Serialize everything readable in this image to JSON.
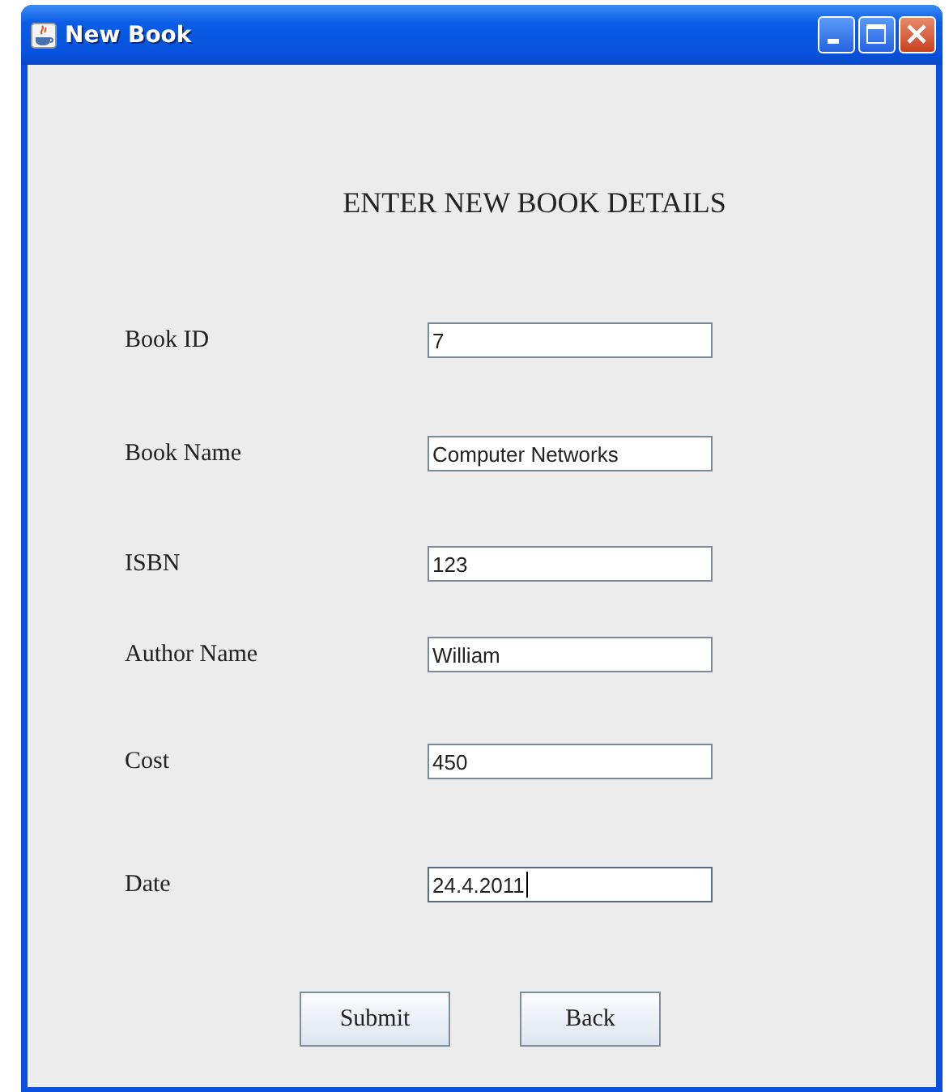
{
  "window": {
    "title": "New Book"
  },
  "heading": "ENTER NEW BOOK DETAILS",
  "fields": [
    {
      "label": "Book ID",
      "value": "7",
      "focused": false
    },
    {
      "label": "Book Name",
      "value": "Computer Networks",
      "focused": false
    },
    {
      "label": "ISBN",
      "value": "123",
      "focused": false
    },
    {
      "label": "Author Name",
      "value": "William",
      "focused": false
    },
    {
      "label": "Cost",
      "value": "450",
      "focused": false
    },
    {
      "label": "Date",
      "value": "24.4.2011",
      "focused": true
    }
  ],
  "buttons": [
    "Submit",
    "Back"
  ]
}
